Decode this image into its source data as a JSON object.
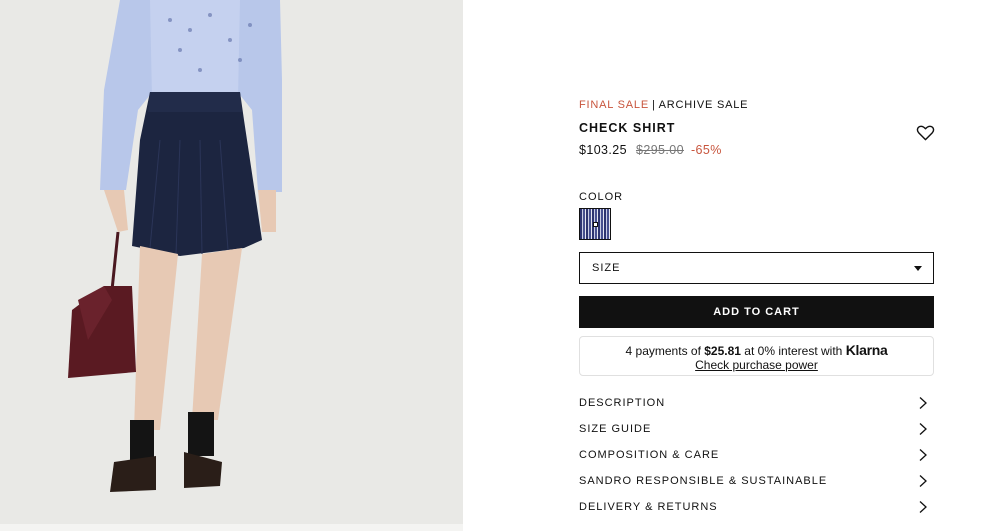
{
  "product": {
    "tag_sale": "FINAL SALE",
    "tag_separator": "|",
    "tag_archive": "ARCHIVE SALE",
    "title": "CHECK SHIRT",
    "price_current": "$103.25",
    "price_original": "$295.00",
    "discount": "-65%",
    "favorite_icon": "heart-icon"
  },
  "color": {
    "label": "COLOR",
    "swatch": "blue stripe"
  },
  "size": {
    "label": "SIZE",
    "icon": "caret-down-icon"
  },
  "cart": {
    "add_label": "ADD TO CART"
  },
  "klarna": {
    "prefix": "4 payments of",
    "amount": "$25.81",
    "suffix": "at 0% interest with",
    "brand": "Klarna",
    "link": "Check purchase power"
  },
  "accordion": {
    "items": [
      {
        "label": "DESCRIPTION"
      },
      {
        "label": "SIZE GUIDE"
      },
      {
        "label": "COMPOSITION & CARE"
      },
      {
        "label": "SANDRO RESPONSIBLE & SUSTAINABLE"
      },
      {
        "label": "DELIVERY & RETURNS"
      }
    ],
    "icon": "chevron-right-icon"
  },
  "colors": {
    "sale": "#c8553d",
    "text": "#111111",
    "button": "#111111",
    "image_bg": "#e9e9e6"
  }
}
